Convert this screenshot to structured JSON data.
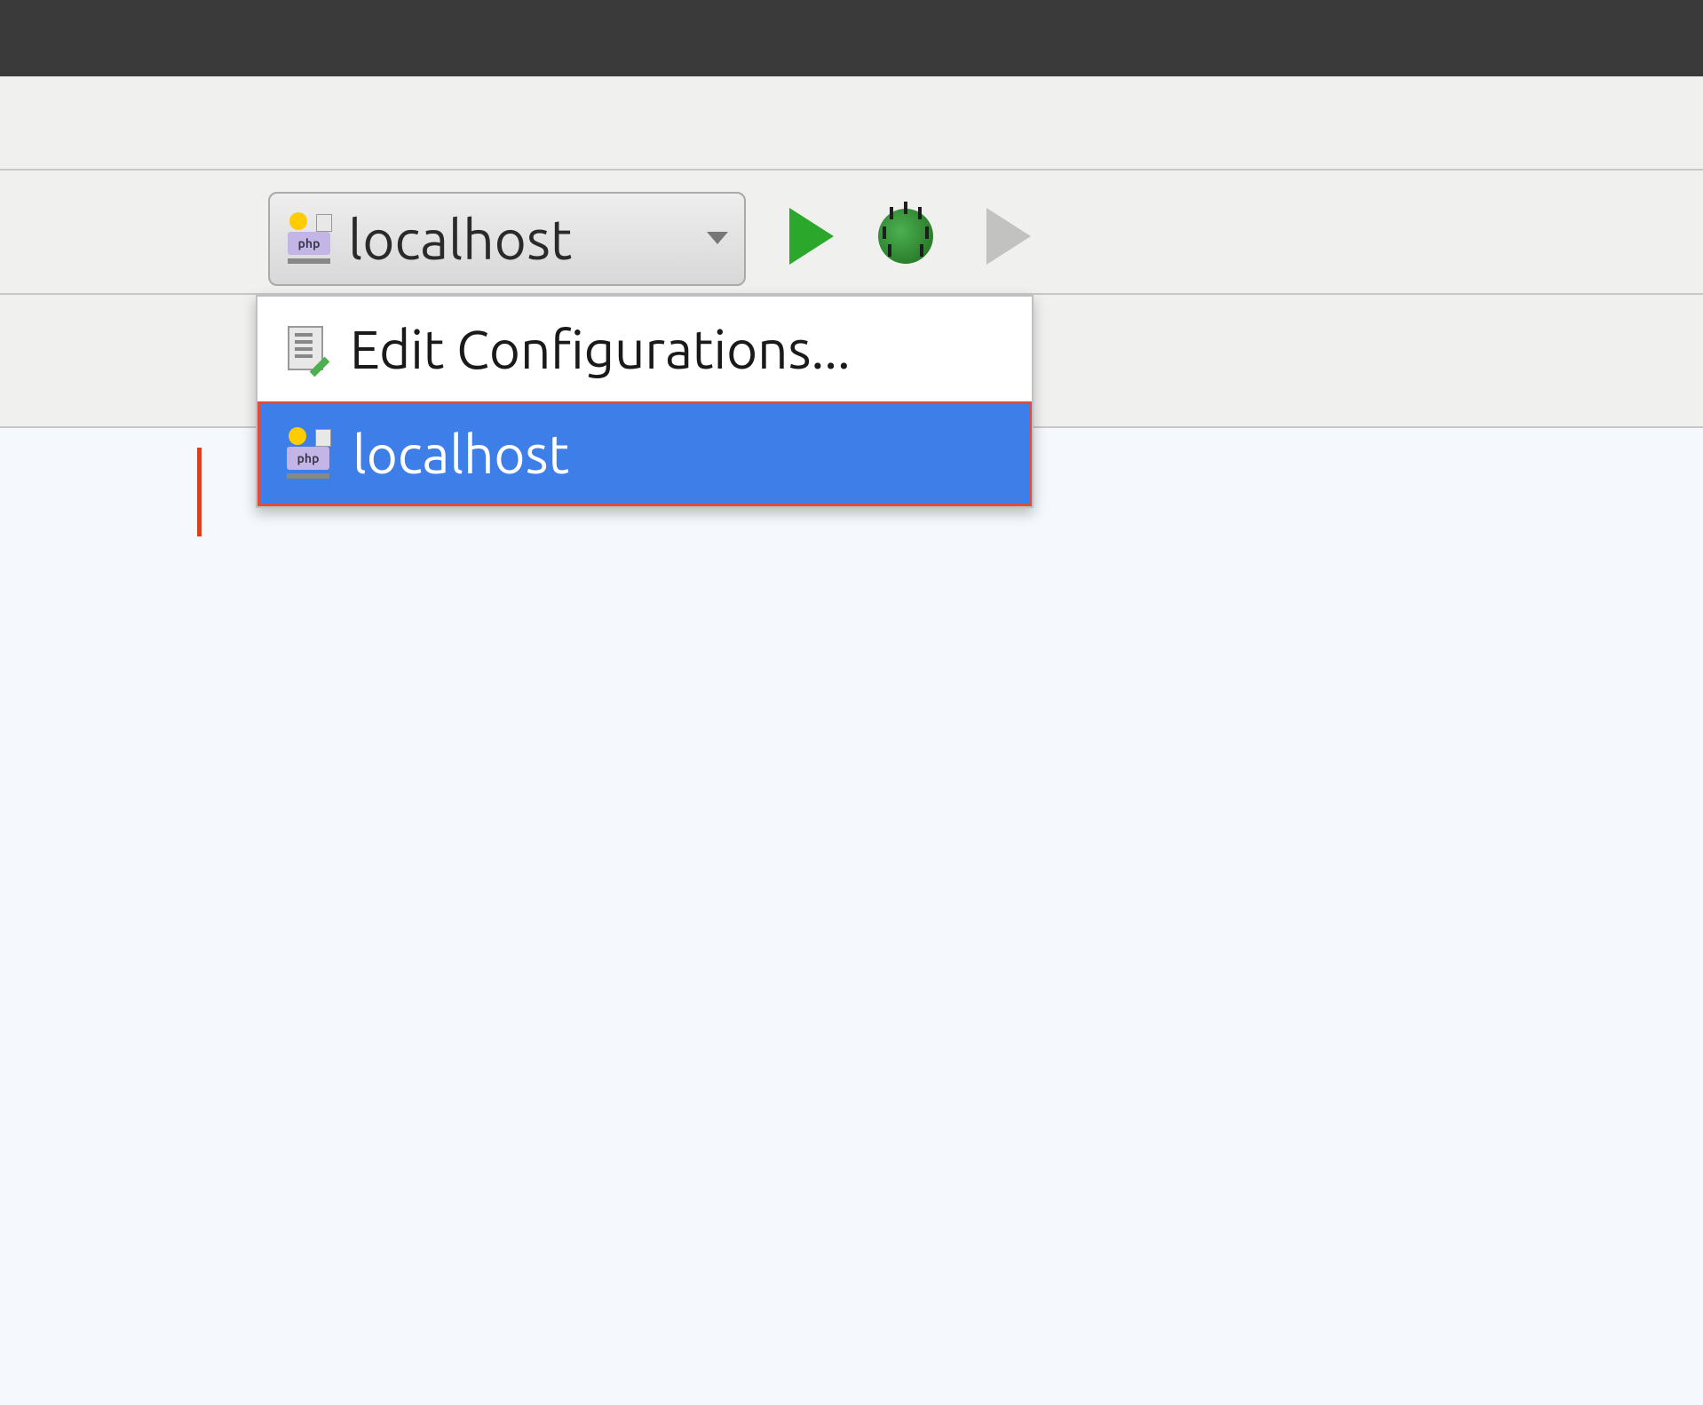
{
  "toolbar": {
    "run_config": {
      "selected_label": "localhost",
      "icon": "php-icon"
    },
    "buttons": {
      "run": "Run",
      "debug": "Debug",
      "coverage": "Run with Coverage"
    }
  },
  "dropdown": {
    "items": [
      {
        "label": "Edit Configurations...",
        "icon": "document-edit-icon",
        "selected": false
      },
      {
        "label": "localhost",
        "icon": "php-icon",
        "selected": true
      }
    ]
  },
  "colors": {
    "selection_bg": "#3e7ee8",
    "highlight_border": "#e24a3a",
    "play_green": "#2ba82b"
  }
}
